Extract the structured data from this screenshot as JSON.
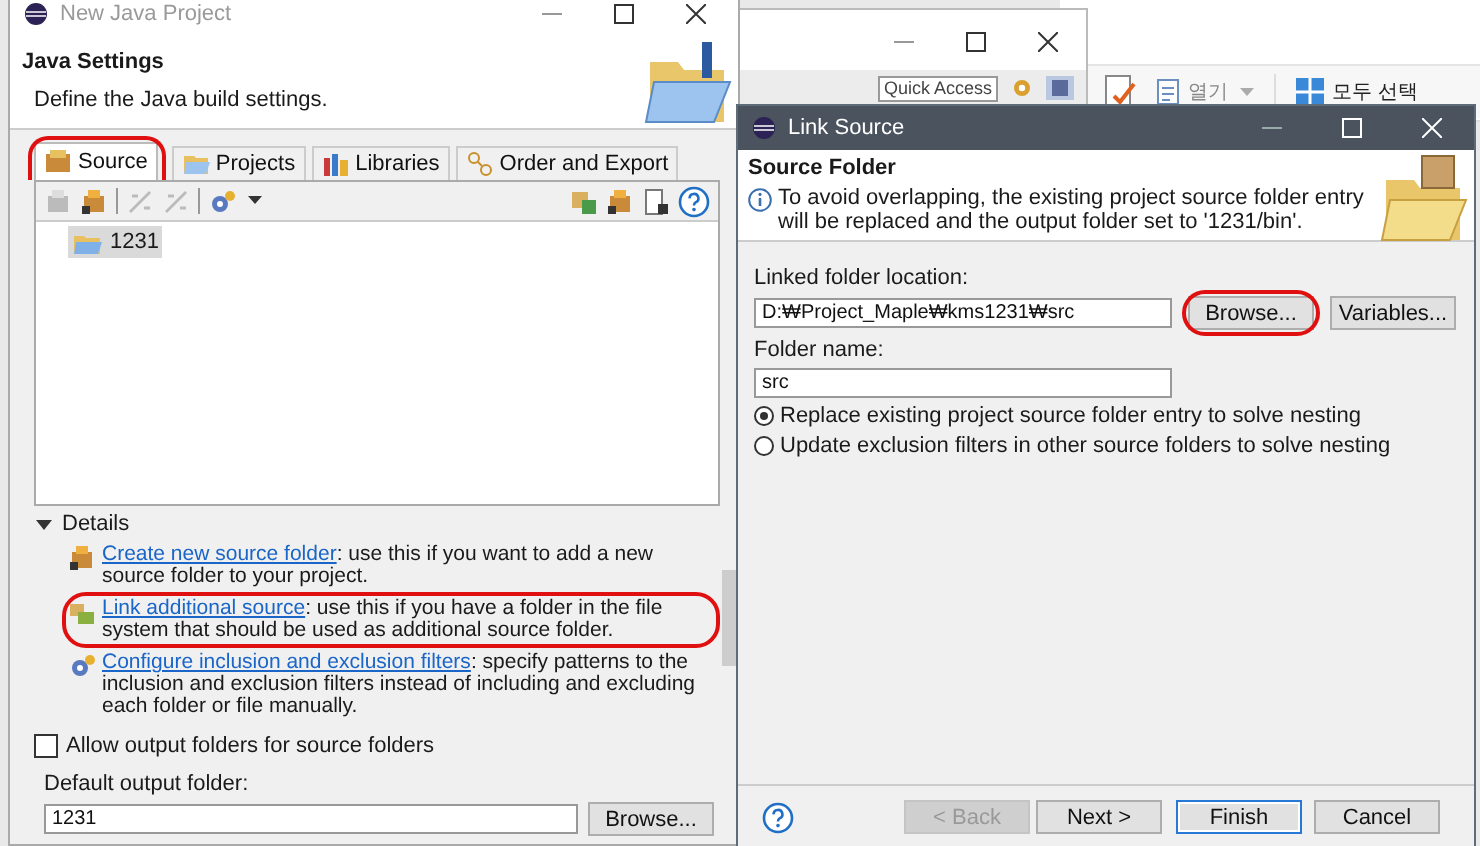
{
  "background_window": {
    "quick_access": "Quick Access"
  },
  "background_app_toolbar": [
    {
      "label": "열기",
      "kind": "dropdown"
    },
    {
      "label": "모두 선택",
      "kind": "grid"
    }
  ],
  "new_project_window": {
    "title": "New Java Project",
    "heading": "Java Settings",
    "description": "Define the Java build settings.",
    "tabs": [
      {
        "label": "Source",
        "selected": true,
        "circled": true
      },
      {
        "label": "Projects",
        "selected": false,
        "circled": false
      },
      {
        "label": "Libraries",
        "selected": false,
        "circled": false
      },
      {
        "label": "Order and Export",
        "selected": false,
        "circled": false
      }
    ],
    "tree": [
      {
        "label": "1231",
        "selected": true
      }
    ],
    "details": {
      "label": "Details",
      "expanded": true,
      "entries": [
        {
          "link": "Create new source folder",
          "text": ": use this if you want to add a new source folder to your project.",
          "circled": false
        },
        {
          "link": "Link additional source",
          "text": ": use this if you have a folder in the file system that should be used as additional source folder.",
          "circled": true
        },
        {
          "link": "Configure inclusion and exclusion filters",
          "text": ": specify patterns to the inclusion and exclusion filters instead of including and excluding each folder or file manually.",
          "circled": false
        }
      ]
    },
    "allow_output_folders": {
      "label": "Allow output folders for source folders",
      "checked": false
    },
    "output_folder": {
      "label": "Default output folder:",
      "value": "1231"
    },
    "browse_button": "Browse..."
  },
  "link_source_dialog": {
    "title": "Link Source",
    "heading": "Source Folder",
    "message": "To avoid overlapping, the existing project source folder entry will be replaced and the output folder set to '1231/bin'.",
    "location": {
      "label": "Linked folder location:",
      "value": "D:₩Project_Maple₩kms1231₩src"
    },
    "browse": {
      "label": "Browse...",
      "circled": true
    },
    "variables_button": "Variables...",
    "folder_name": {
      "label": "Folder name:",
      "value": "src"
    },
    "options": [
      {
        "label": "Replace existing project source folder entry to solve nesting",
        "selected": true
      },
      {
        "label": "Update exclusion filters in other source folders to solve nesting",
        "selected": false
      }
    ],
    "buttons": [
      {
        "label": "< Back",
        "disabled": true,
        "default": false
      },
      {
        "label": "Next >",
        "disabled": false,
        "default": false
      },
      {
        "label": "Finish",
        "disabled": false,
        "default": true
      },
      {
        "label": "Cancel",
        "disabled": false,
        "default": false
      }
    ]
  }
}
